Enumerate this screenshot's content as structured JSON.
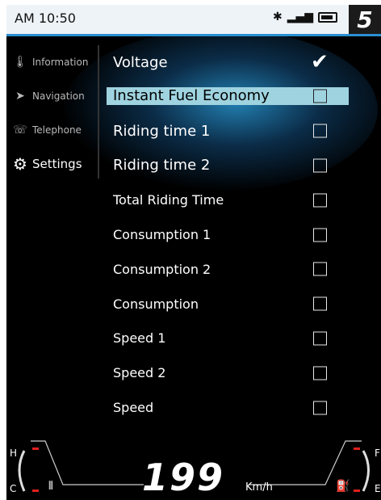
{
  "status": {
    "time": "AM 10:50",
    "logo": "5"
  },
  "sidebar": {
    "items": [
      {
        "label": "Information",
        "icon": "thermometer-icon"
      },
      {
        "label": "Navigation",
        "icon": "navigation-arrow-icon"
      },
      {
        "label": "Telephone",
        "icon": "phone-icon"
      },
      {
        "label": "Settings",
        "icon": "gear-icon"
      }
    ]
  },
  "list": {
    "items": [
      {
        "label": "Voltage",
        "checked": true
      },
      {
        "label": "Instant Fuel Economy",
        "checked": false,
        "selected": true
      },
      {
        "label": "Riding time 1",
        "checked": false
      },
      {
        "label": "Riding time 2",
        "checked": false
      },
      {
        "label": "Total Riding Time",
        "checked": false
      },
      {
        "label": "Consumption 1",
        "checked": false
      },
      {
        "label": "Consumption 2",
        "checked": false
      },
      {
        "label": "Consumption",
        "checked": false
      },
      {
        "label": "Speed 1",
        "checked": false
      },
      {
        "label": "Speed 2",
        "checked": false
      },
      {
        "label": "Speed",
        "checked": false
      }
    ]
  },
  "gauges": {
    "speed": "199",
    "speed_unit": "Km/h",
    "temp_high": "H",
    "temp_low": "C",
    "fuel_full": "F",
    "fuel_empty": "E"
  },
  "colors": {
    "accent": "#2a8fd0",
    "selected_row": "#9fd3e0",
    "gauge_marker": "#e0201e"
  }
}
